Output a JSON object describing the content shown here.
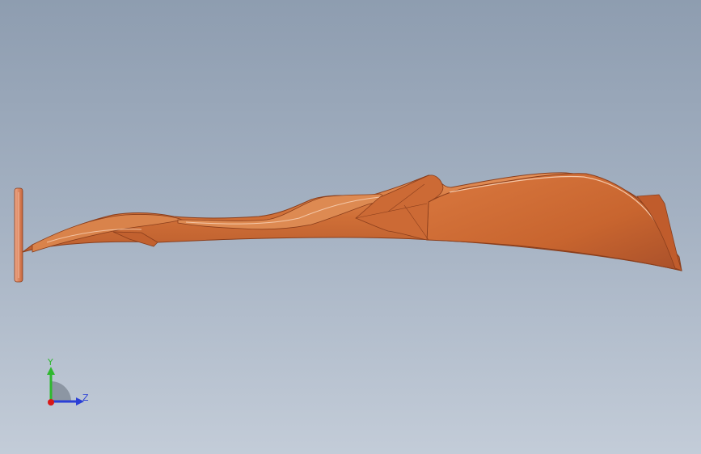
{
  "viewport": {
    "background_top": "#8e9db0",
    "background_bottom": "#c3ccd8"
  },
  "model": {
    "name": "part-model",
    "color": "#d2773f"
  },
  "triad": {
    "y_label": "Y",
    "z_label": "Z",
    "y_color": "#2fb82f",
    "z_color": "#2a3fd6",
    "x_color": "#d81818"
  }
}
